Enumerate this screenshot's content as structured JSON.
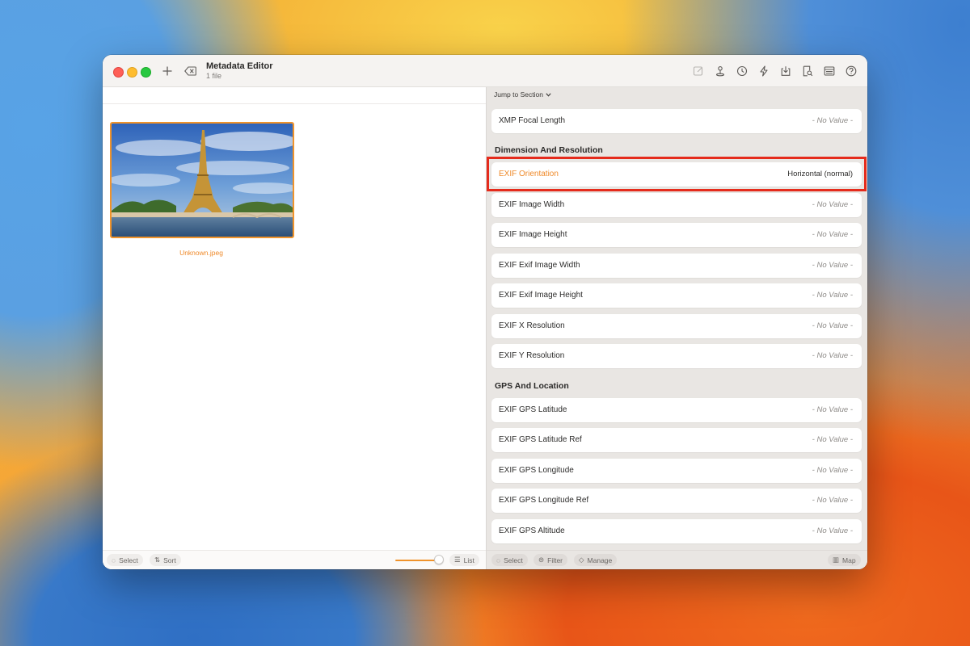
{
  "window": {
    "title": "Metadata Editor",
    "subtitle": "1 file",
    "toolbar_icons": [
      "edit-icon",
      "location-pin-icon",
      "clock-icon",
      "bolt-icon",
      "download-icon",
      "search-document-icon",
      "layout-icon",
      "help-icon"
    ]
  },
  "left": {
    "file_name": "Unknown.jpeg",
    "footer": {
      "select": "Select",
      "sort": "Sort",
      "list": "List",
      "thumbnail_size": 0.92
    }
  },
  "right": {
    "jump_label": "Jump to Section",
    "top_field": {
      "name": "XMP Focal Length",
      "value": "- No Value -"
    },
    "sections": [
      {
        "title": "Dimension And Resolution",
        "fields": [
          {
            "name": "EXIF Orientation",
            "value": "Horizontal (normal)"
          },
          {
            "name": "EXIF Image Width",
            "value": "- No Value -"
          },
          {
            "name": "EXIF Image Height",
            "value": "- No Value -"
          },
          {
            "name": "EXIF Exif Image Width",
            "value": "- No Value -"
          },
          {
            "name": "EXIF Exif Image Height",
            "value": "- No Value -"
          },
          {
            "name": "EXIF X Resolution",
            "value": "- No Value -"
          },
          {
            "name": "EXIF Y Resolution",
            "value": "- No Value -"
          }
        ]
      },
      {
        "title": "GPS And Location",
        "fields": [
          {
            "name": "EXIF GPS Latitude",
            "value": "- No Value -"
          },
          {
            "name": "EXIF GPS Latitude Ref",
            "value": "- No Value -"
          },
          {
            "name": "EXIF GPS Longitude",
            "value": "- No Value -"
          },
          {
            "name": "EXIF GPS Longitude Ref",
            "value": "- No Value -"
          },
          {
            "name": "EXIF GPS Altitude",
            "value": "- No Value -"
          }
        ]
      }
    ],
    "footer": {
      "select": "Select",
      "filter": "Filter",
      "manage": "Manage",
      "map": "Map"
    }
  },
  "colors": {
    "accent": "#ef8a2a",
    "highlight_box": "#e52b1c"
  }
}
